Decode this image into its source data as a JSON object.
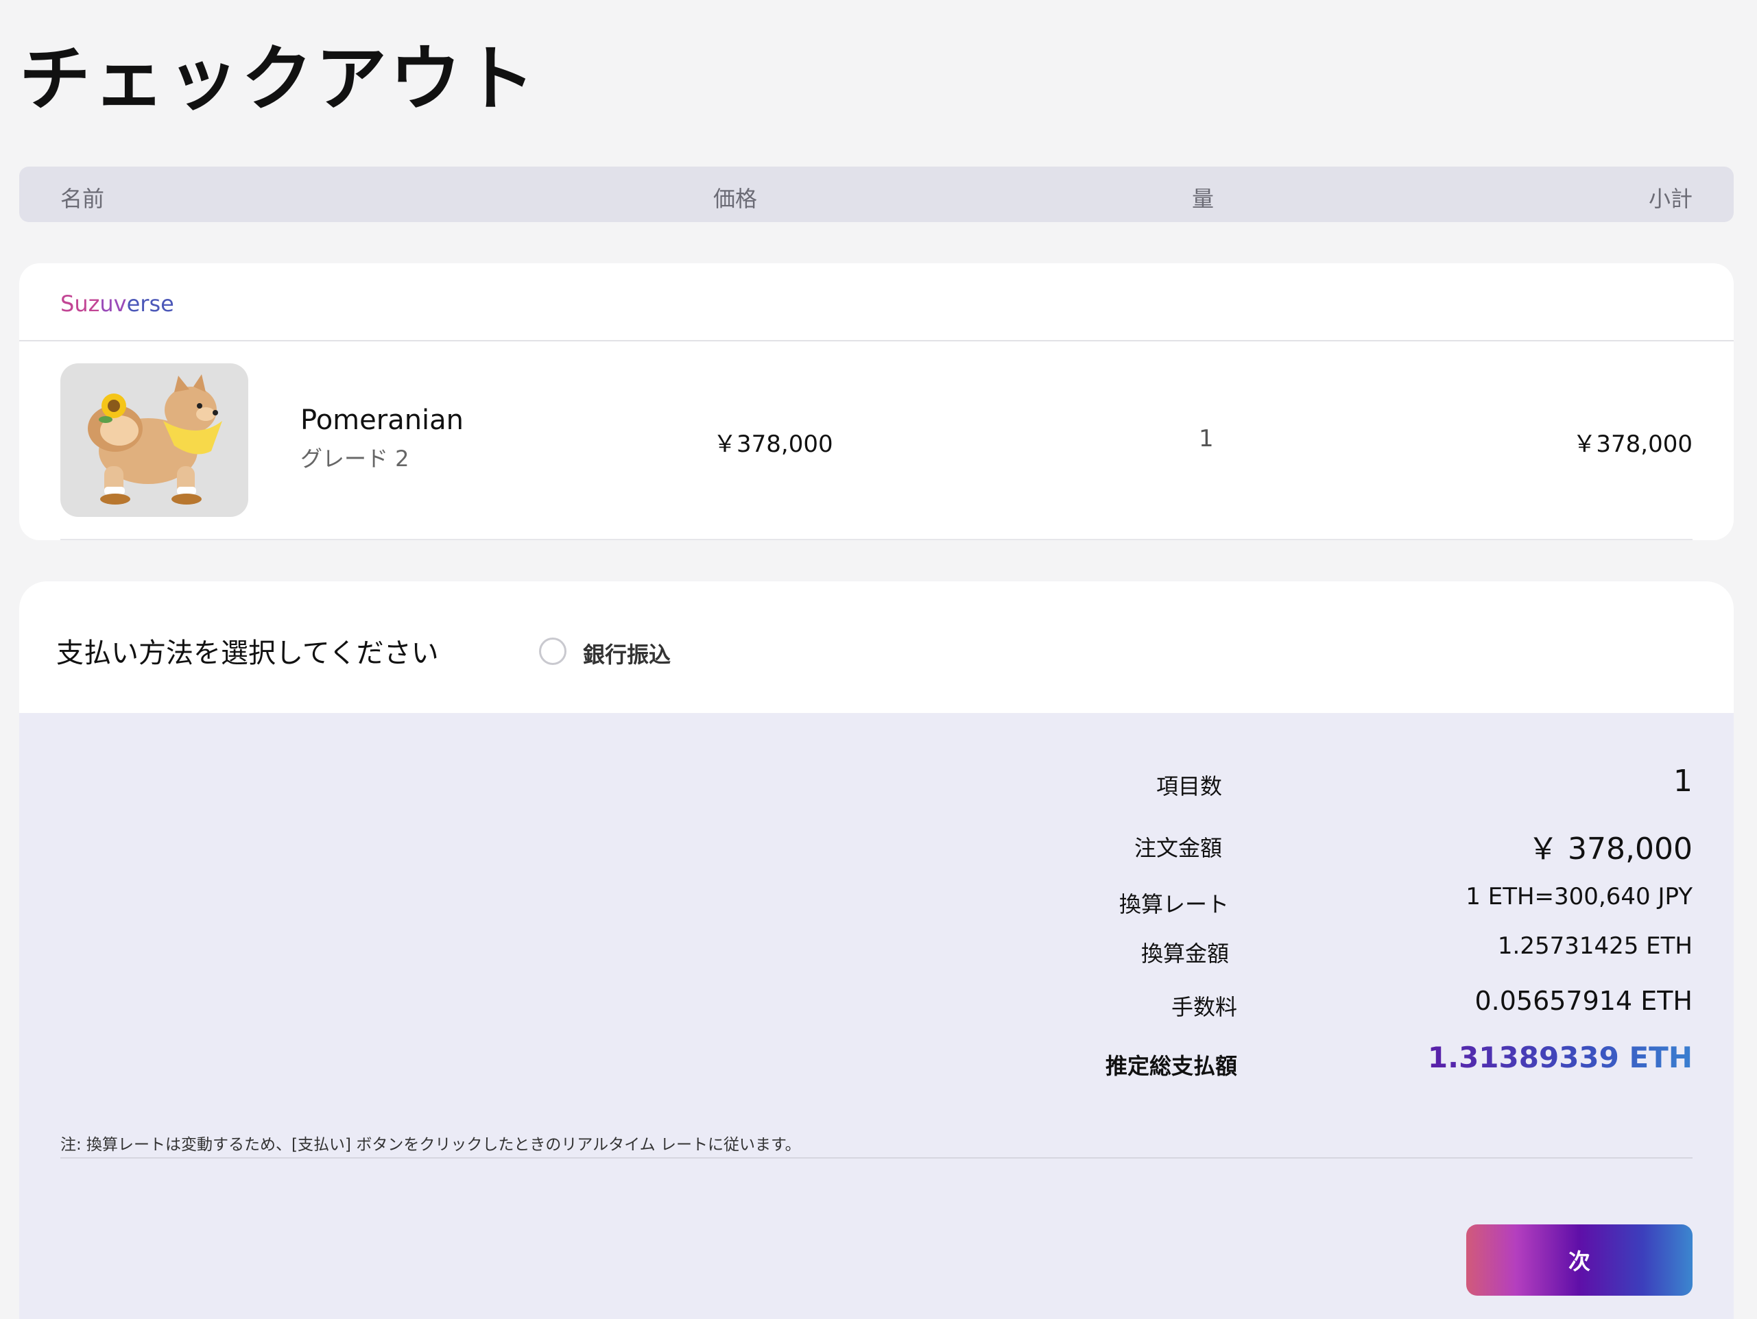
{
  "page": {
    "title": "チェックアウト"
  },
  "table_header": {
    "name": "名前",
    "price": "価格",
    "quantity": "量",
    "subtotal": "小計"
  },
  "shop": {
    "brand_part1": "Suz",
    "brand_part2": "uv",
    "brand_part3": "erse"
  },
  "item": {
    "name": "Pomeranian",
    "grade": "グレード 2",
    "price": "￥378,000",
    "quantity": "1",
    "subtotal": "￥378,000",
    "image_icon": "pomeranian-sunflower-illustration"
  },
  "payment": {
    "prompt": "支払い方法を選択してください",
    "options": [
      {
        "label": "銀行振込",
        "selected": false
      }
    ]
  },
  "summary": {
    "item_count_label": "項目数",
    "item_count": "1",
    "order_amount_label": "注文金額",
    "order_amount": "￥ 378,000",
    "rate_label": "換算レート",
    "rate": "1 ETH=300,640 JPY",
    "converted_label": "換算金額",
    "converted": "1.25731425 ETH",
    "fee_label": "手数料",
    "fee": "0.05657914 ETH",
    "total_label": "推定総支払額",
    "total": "1.31389339 ETH"
  },
  "note": "注: 換算レートは変動するため、[支払い] ボタンをクリックしたときのリアルタイム レートに従います。",
  "next_button": {
    "label": "次"
  },
  "colors": {
    "page_bg": "#f4f4f5",
    "header_bg": "#e1e1ea",
    "summary_bg": "#ebebf6",
    "accent_start": "#d15a7a",
    "accent_mid": "#5f0fa8",
    "accent_end": "#3c86cf"
  }
}
